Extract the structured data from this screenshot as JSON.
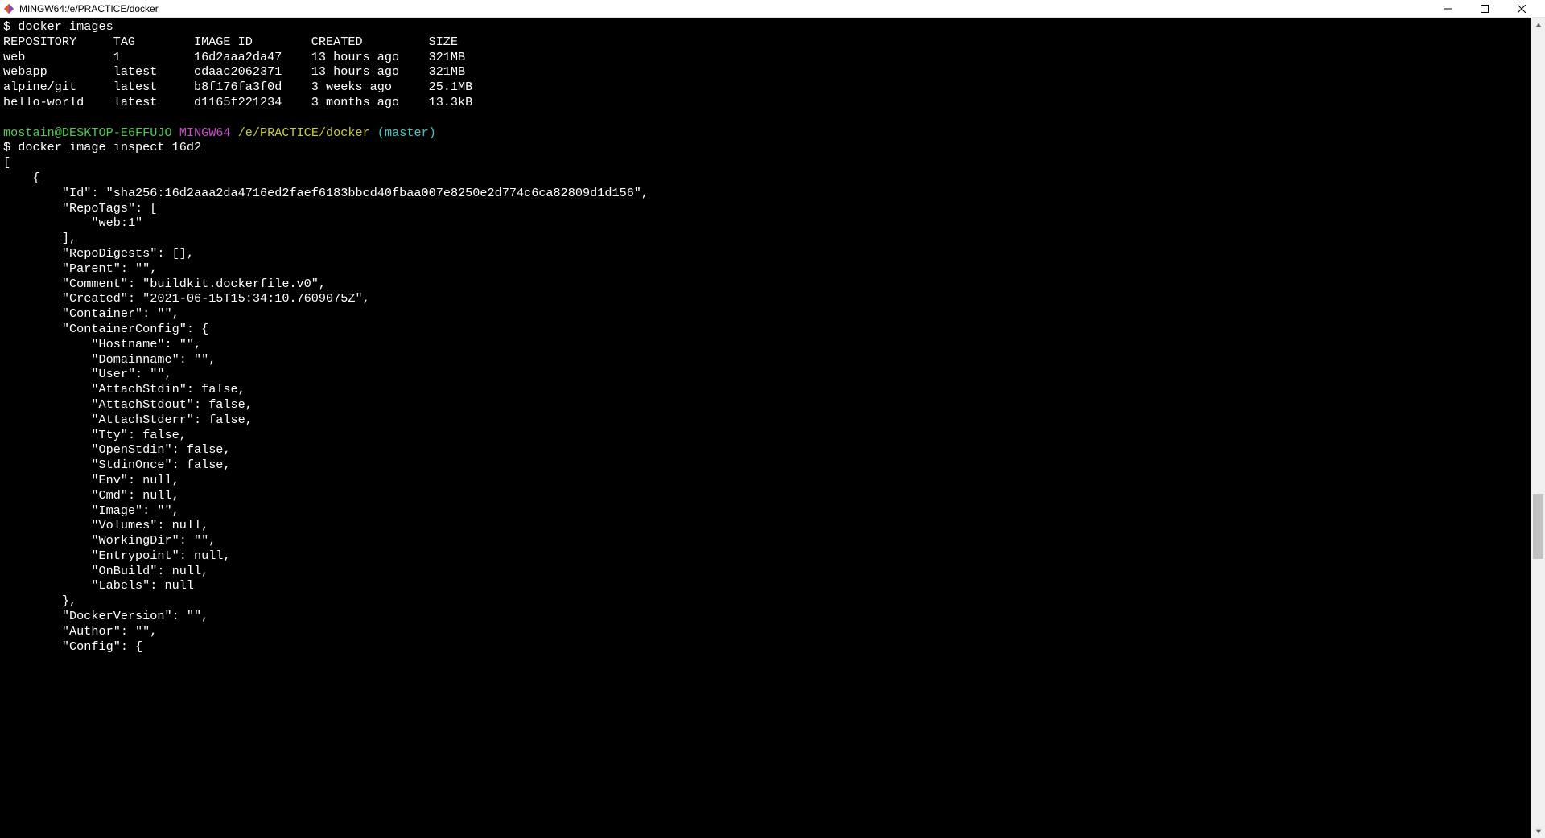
{
  "window": {
    "title": "MINGW64:/e/PRACTICE/docker"
  },
  "prompt": {
    "user_host": "mostain@DESKTOP-E6FFUJO",
    "shell": "MINGW64",
    "cwd": "/e/PRACTICE/docker",
    "branch": "(master)"
  },
  "cmd1": "$ docker images",
  "images_header": {
    "col0": "REPOSITORY",
    "col1": "TAG",
    "col2": "IMAGE ID",
    "col3": "CREATED",
    "col4": "SIZE"
  },
  "images": [
    {
      "repo": "web",
      "tag": "1",
      "id": "16d2aaa2da47",
      "created": "13 hours ago",
      "size": "321MB"
    },
    {
      "repo": "webapp",
      "tag": "latest",
      "id": "cdaac2062371",
      "created": "13 hours ago",
      "size": "321MB"
    },
    {
      "repo": "alpine/git",
      "tag": "latest",
      "id": "b8f176fa3f0d",
      "created": "3 weeks ago",
      "size": "25.1MB"
    },
    {
      "repo": "hello-world",
      "tag": "latest",
      "id": "d1165f221234",
      "created": "3 months ago",
      "size": "13.3kB"
    }
  ],
  "cmd2": "$ docker image inspect 16d2",
  "inspect": {
    "l0": "[",
    "l1": "    {",
    "l2": "        \"Id\": \"sha256:16d2aaa2da4716ed2faef6183bbcd40fbaa007e8250e2d774c6ca82809d1d156\",",
    "l3": "        \"RepoTags\": [",
    "l4": "            \"web:1\"",
    "l5": "        ],",
    "l6": "        \"RepoDigests\": [],",
    "l7": "        \"Parent\": \"\",",
    "l8": "        \"Comment\": \"buildkit.dockerfile.v0\",",
    "l9": "        \"Created\": \"2021-06-15T15:34:10.7609075Z\",",
    "l10": "        \"Container\": \"\",",
    "l11": "        \"ContainerConfig\": {",
    "l12": "            \"Hostname\": \"\",",
    "l13": "            \"Domainname\": \"\",",
    "l14": "            \"User\": \"\",",
    "l15": "            \"AttachStdin\": false,",
    "l16": "            \"AttachStdout\": false,",
    "l17": "            \"AttachStderr\": false,",
    "l18": "            \"Tty\": false,",
    "l19": "            \"OpenStdin\": false,",
    "l20": "            \"StdinOnce\": false,",
    "l21": "            \"Env\": null,",
    "l22": "            \"Cmd\": null,",
    "l23": "            \"Image\": \"\",",
    "l24": "            \"Volumes\": null,",
    "l25": "            \"WorkingDir\": \"\",",
    "l26": "            \"Entrypoint\": null,",
    "l27": "            \"OnBuild\": null,",
    "l28": "            \"Labels\": null",
    "l29": "        },",
    "l30": "        \"DockerVersion\": \"\",",
    "l31": "        \"Author\": \"\",",
    "l32": "        \"Config\": {"
  }
}
